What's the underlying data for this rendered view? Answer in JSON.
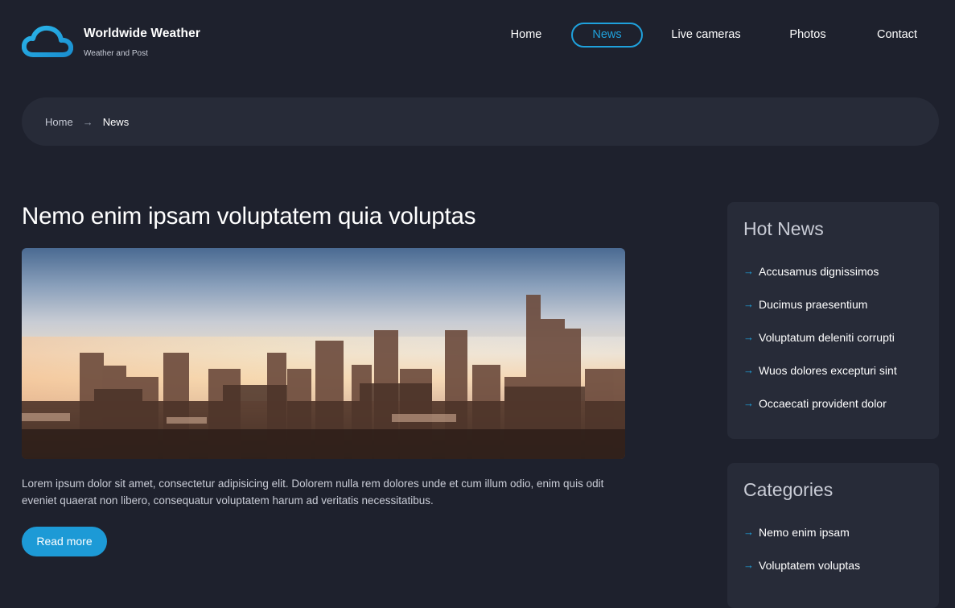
{
  "brand": {
    "title": "Worldwide Weather",
    "subtitle": "Weather and Post",
    "accent": "#1fa1dc",
    "icon": "cloud-icon"
  },
  "nav": {
    "items": [
      {
        "label": "Home"
      },
      {
        "label": "News",
        "active": true
      },
      {
        "label": "Live cameras"
      },
      {
        "label": "Photos"
      },
      {
        "label": "Contact"
      }
    ]
  },
  "breadcrumb": {
    "home": "Home",
    "separator": "→",
    "current": "News"
  },
  "article": {
    "title": "Nemo enim ipsam voluptatem quia voluptas",
    "image": "city-skyline-image",
    "excerpt": "Lorem ipsum dolor sit amet, consectetur adipisicing elit. Dolorem nulla rem dolores unde et cum illum odio, enim quis odit eveniet quaerat non libero, consequatur voluptatem harum ad veritatis necessitatibus.",
    "read_more": "Read more"
  },
  "sidebar": {
    "hot_news": {
      "title": "Hot News",
      "items": [
        {
          "label": "Accusamus dignissimos"
        },
        {
          "label": "Ducimus praesentium"
        },
        {
          "label": "Voluptatum deleniti corrupti"
        },
        {
          "label": "Wuos dolores excepturi sint"
        },
        {
          "label": "Occaecati provident dolor"
        }
      ]
    },
    "categories": {
      "title": "Categories",
      "items": [
        {
          "label": "Nemo enim ipsam"
        },
        {
          "label": "Voluptatem voluptas"
        }
      ]
    },
    "arrow": "→"
  }
}
